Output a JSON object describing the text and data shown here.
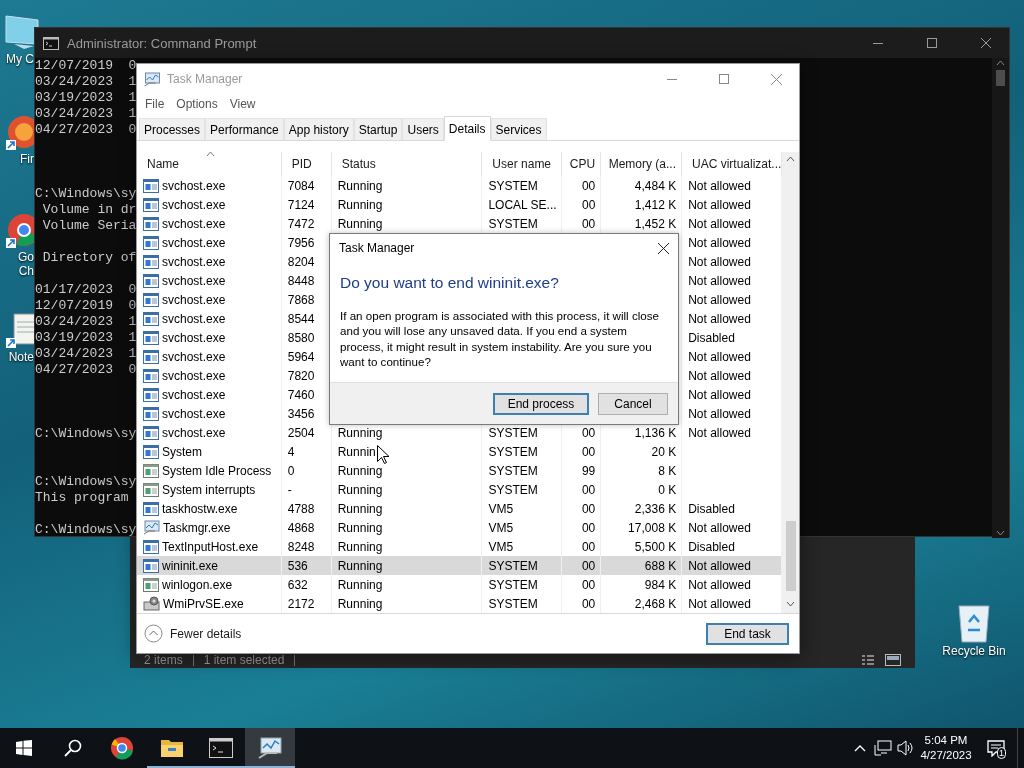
{
  "desktop_icons": [
    {
      "kind": "computer",
      "lines": [
        "My C"
      ]
    },
    {
      "kind": "firefox",
      "lines": [
        "Fir"
      ]
    },
    {
      "kind": "chrome",
      "lines": [
        "Go",
        "Ch"
      ]
    },
    {
      "kind": "notepad",
      "lines": [
        "Note"
      ]
    },
    {
      "kind": "recycle",
      "lines": [
        "Recycle Bin"
      ]
    }
  ],
  "cmd_window": {
    "title": "Administrator: Command Prompt",
    "blocks": [
      [
        "12/07/2019  0",
        "03/24/2023  1",
        "03/19/2023  1",
        "03/24/2023  1",
        "04/27/2023  0"
      ],
      [
        "C:\\Windows\\sy",
        " Volume in dr",
        " Volume Seria"
      ],
      [
        " Directory of"
      ],
      [
        "01/17/2023  0",
        "12/07/2019  0",
        "03/24/2023  1",
        "03/19/2023  1",
        "03/24/2023  1",
        "04/27/2023  0"
      ],
      [
        "C:\\Windows\\sy"
      ],
      [
        "C:\\Windows\\sy",
        "This program"
      ],
      [
        "C:\\Windows\\sy"
      ]
    ]
  },
  "explorer_status": [
    "2 items",
    "1 item selected"
  ],
  "task_manager": {
    "title": "Task Manager",
    "menu": [
      "File",
      "Options",
      "View"
    ],
    "tabs": [
      {
        "label": "Processes",
        "selected": false
      },
      {
        "label": "Performance",
        "selected": false
      },
      {
        "label": "App history",
        "selected": false
      },
      {
        "label": "Startup",
        "selected": false
      },
      {
        "label": "Users",
        "selected": false
      },
      {
        "label": "Details",
        "selected": true
      },
      {
        "label": "Services",
        "selected": false
      }
    ],
    "columns": [
      "Name",
      "PID",
      "Status",
      "User name",
      "CPU",
      "Memory (a...",
      "UAC virtualizat..."
    ],
    "rows": [
      {
        "kind": "service",
        "name": "svchost.exe",
        "pid": "7084",
        "status": "Running",
        "user": "SYSTEM",
        "cpu": "00",
        "memory": "4,484 K",
        "uac": "Not allowed",
        "selected": false
      },
      {
        "kind": "service",
        "name": "svchost.exe",
        "pid": "7124",
        "status": "Running",
        "user": "LOCAL SE...",
        "cpu": "00",
        "memory": "1,412 K",
        "uac": "Not allowed",
        "selected": false
      },
      {
        "kind": "service",
        "name": "svchost.exe",
        "pid": "7472",
        "status": "Running",
        "user": "SYSTEM",
        "cpu": "00",
        "memory": "1,452 K",
        "uac": "Not allowed",
        "selected": false
      },
      {
        "kind": "service",
        "name": "svchost.exe",
        "pid": "7956",
        "uac": "Not allowed",
        "selected": false
      },
      {
        "kind": "service",
        "name": "svchost.exe",
        "pid": "8204",
        "uac": "Not allowed",
        "selected": false
      },
      {
        "kind": "service",
        "name": "svchost.exe",
        "pid": "8448",
        "uac": "Not allowed",
        "selected": false
      },
      {
        "kind": "service",
        "name": "svchost.exe",
        "pid": "7868",
        "uac": "Not allowed",
        "selected": false
      },
      {
        "kind": "service",
        "name": "svchost.exe",
        "pid": "8544",
        "uac": "Not allowed",
        "selected": false
      },
      {
        "kind": "service",
        "name": "svchost.exe",
        "pid": "8580",
        "uac": "Disabled",
        "selected": false
      },
      {
        "kind": "service",
        "name": "svchost.exe",
        "pid": "5964",
        "uac": "Not allowed",
        "selected": false
      },
      {
        "kind": "service",
        "name": "svchost.exe",
        "pid": "7820",
        "uac": "Not allowed",
        "selected": false
      },
      {
        "kind": "service",
        "name": "svchost.exe",
        "pid": "7460",
        "uac": "Not allowed",
        "selected": false
      },
      {
        "kind": "service",
        "name": "svchost.exe",
        "pid": "3456",
        "uac": "Not allowed",
        "selected": false
      },
      {
        "kind": "service",
        "name": "svchost.exe",
        "pid": "2504",
        "status": "Running",
        "user": "SYSTEM",
        "cpu": "00",
        "memory": "1,136 K",
        "uac": "Not allowed",
        "selected": false
      },
      {
        "kind": "service",
        "name": "System",
        "pid": "4",
        "status": "Runnin",
        "user": "SYSTEM",
        "cpu": "00",
        "memory": "20 K",
        "selected": false
      },
      {
        "kind": "system",
        "name": "System Idle Process",
        "pid": "0",
        "status": "Running",
        "user": "SYSTEM",
        "cpu": "99",
        "memory": "8 K",
        "selected": false
      },
      {
        "kind": "system",
        "name": "System interrupts",
        "pid": "-",
        "status": "Running",
        "user": "SYSTEM",
        "cpu": "00",
        "memory": "0 K",
        "selected": false
      },
      {
        "kind": "service",
        "name": "taskhostw.exe",
        "pid": "4788",
        "status": "Running",
        "user": "VM5",
        "cpu": "00",
        "memory": "2,336 K",
        "uac": "Disabled",
        "selected": false
      },
      {
        "kind": "taskmgr",
        "name": "Taskmgr.exe",
        "pid": "4868",
        "status": "Running",
        "user": "VM5",
        "cpu": "00",
        "memory": "17,008 K",
        "uac": "Not allowed",
        "selected": false
      },
      {
        "kind": "service",
        "name": "TextInputHost.exe",
        "pid": "8248",
        "status": "Running",
        "user": "VM5",
        "cpu": "00",
        "memory": "5,500 K",
        "uac": "Disabled",
        "selected": false
      },
      {
        "kind": "service",
        "name": "wininit.exe",
        "pid": "536",
        "status": "Running",
        "user": "SYSTEM",
        "cpu": "00",
        "memory": "688 K",
        "uac": "Not allowed",
        "selected": true
      },
      {
        "kind": "system",
        "name": "winlogon.exe",
        "pid": "632",
        "status": "Running",
        "user": "SYSTEM",
        "cpu": "00",
        "memory": "984 K",
        "uac": "Not allowed",
        "selected": false
      },
      {
        "kind": "wmi",
        "name": "WmiPrvSE.exe",
        "pid": "2172",
        "status": "Running",
        "user": "SYSTEM",
        "cpu": "00",
        "memory": "2,468 K",
        "uac": "Not allowed",
        "selected": false
      }
    ],
    "fewer_details": "Fewer details",
    "end_task": {
      "label": "End task",
      "default": true
    }
  },
  "dialog": {
    "title": "Task Manager",
    "heading": "Do you want to end wininit.exe?",
    "message": "If an open program is associated with this process, it will close and you will lose any unsaved data. If you end a system process, it might result in system instability. Are you sure you want to continue?",
    "buttons": [
      {
        "label": "End process",
        "default": true
      },
      {
        "label": "Cancel",
        "default": false
      }
    ]
  },
  "taskbar": {
    "apps": [
      {
        "kind": "chrome",
        "running": false,
        "selected": false
      },
      {
        "kind": "explorer",
        "running": true,
        "selected": false
      },
      {
        "kind": "cmd",
        "running": true,
        "selected": false
      },
      {
        "kind": "taskmgr",
        "running": true,
        "selected": true
      }
    ],
    "time": "5:04 PM",
    "date": "4/27/2023",
    "notifications": "1"
  }
}
